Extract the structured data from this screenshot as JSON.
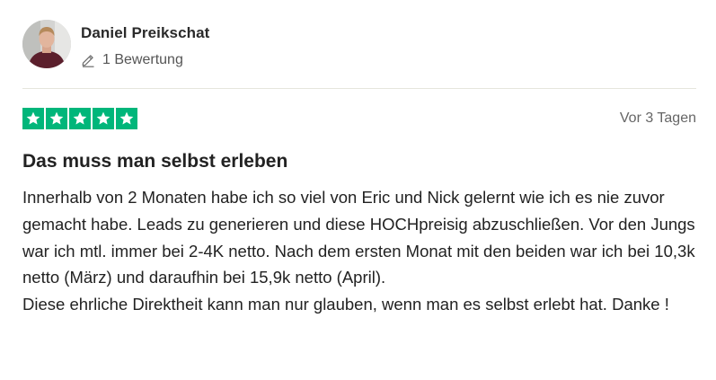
{
  "reviewer": {
    "name": "Daniel Preikschat",
    "review_count_label": "1 Bewertung",
    "avatar": "avatar-photo"
  },
  "review": {
    "rating": 5,
    "rating_max": 5,
    "rating_color": "#00b67a",
    "date": "Vor 3 Tagen",
    "title": "Das muss man selbst erleben",
    "paragraphs": [
      "Innerhalb von 2 Monaten habe ich so viel von Eric und Nick gelernt wie ich es nie zuvor gemacht habe. Leads zu generieren und diese HOCHpreisig abzuschließen. Vor den Jungs war ich mtl. immer bei 2-4K netto. Nach dem ersten Monat mit den beiden war ich bei 10,3k netto (März) und daraufhin bei 15,9k netto (April).",
      "Diese ehrliche Direktheit kann man nur glauben, wenn man es selbst erlebt hat. Danke !"
    ]
  },
  "icons": {
    "review_count": "pencil-icon",
    "rating": "star-icon"
  }
}
